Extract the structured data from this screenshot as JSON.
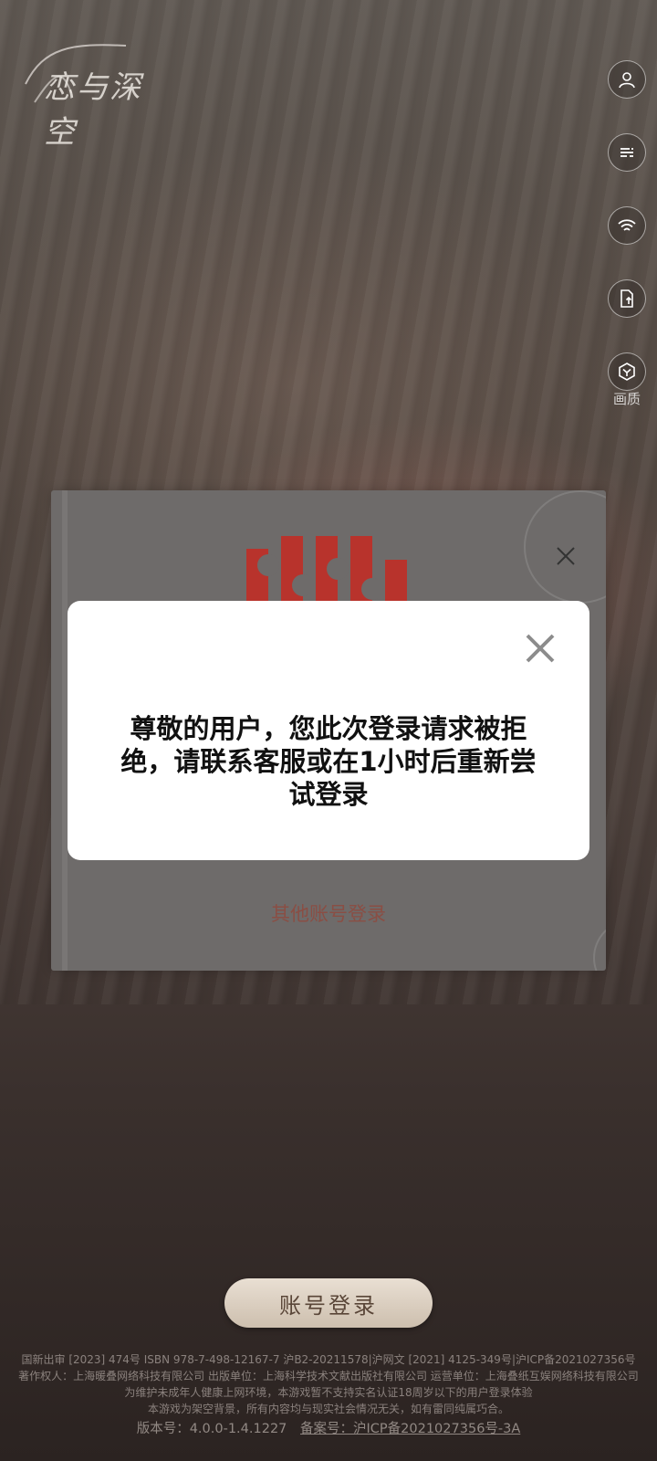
{
  "app": {
    "logo_text": "恋与深空"
  },
  "side_buttons": {
    "quality_label": "画质"
  },
  "login_panel": {
    "other_login_label": "其他账号登录"
  },
  "modal": {
    "message": "尊敬的用户，您此次登录请求被拒绝，请联系客服或在1小时后重新尝试登录"
  },
  "bottom": {
    "account_login_label": "账号登录",
    "footer_lines": [
      "国新出审 [2023] 474号  ISBN 978-7-498-12167-7  沪B2-20211578|沪网文 [2021] 4125-349号|沪ICP备2021027356号",
      "著作权人：上海暖叠网络科技有限公司 出版单位：上海科学技术文献出版社有限公司 运营单位：上海叠纸互娱网络科技有限公司",
      "为维护未成年人健康上网环境，本游戏暂不支持实名认证18周岁以下的用户登录体验",
      "本游戏为架空背景，所有内容均与现实社会情况无关，如有雷同纯属巧合。"
    ],
    "version": "版本号：4.0.0-1.4.1227",
    "beian": "备案号：沪ICP备2021027356号-3A"
  }
}
